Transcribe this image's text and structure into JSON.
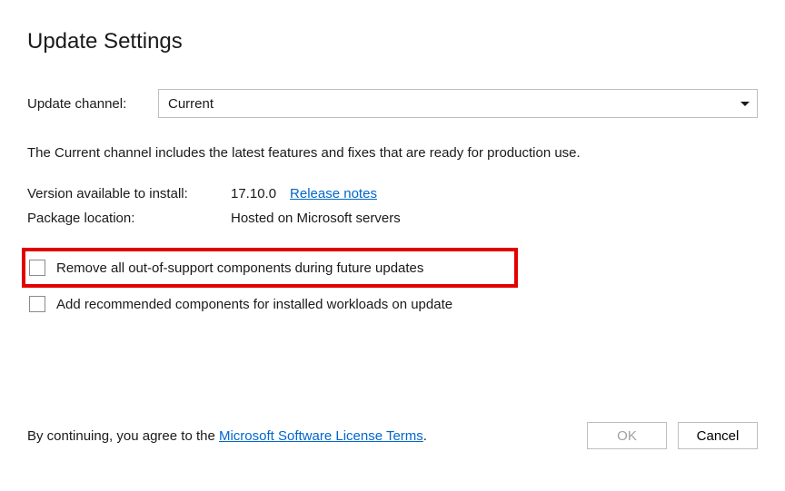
{
  "title": "Update Settings",
  "channel": {
    "label": "Update channel:",
    "selected": "Current"
  },
  "description": "The Current channel includes the latest features and fixes that are ready for production use.",
  "versionRow": {
    "label": "Version available to install:",
    "value": "17.10.0",
    "releaseNotesLink": "Release notes"
  },
  "packageRow": {
    "label": "Package location:",
    "value": "Hosted on Microsoft servers"
  },
  "checkboxes": {
    "removeOutOfSupport": "Remove all out-of-support components during future updates",
    "addRecommended": "Add recommended components for installed workloads on update"
  },
  "footer": {
    "prefix": "By continuing, you agree to the ",
    "linkText": "Microsoft Software License Terms",
    "suffix": "."
  },
  "buttons": {
    "ok": "OK",
    "cancel": "Cancel"
  }
}
